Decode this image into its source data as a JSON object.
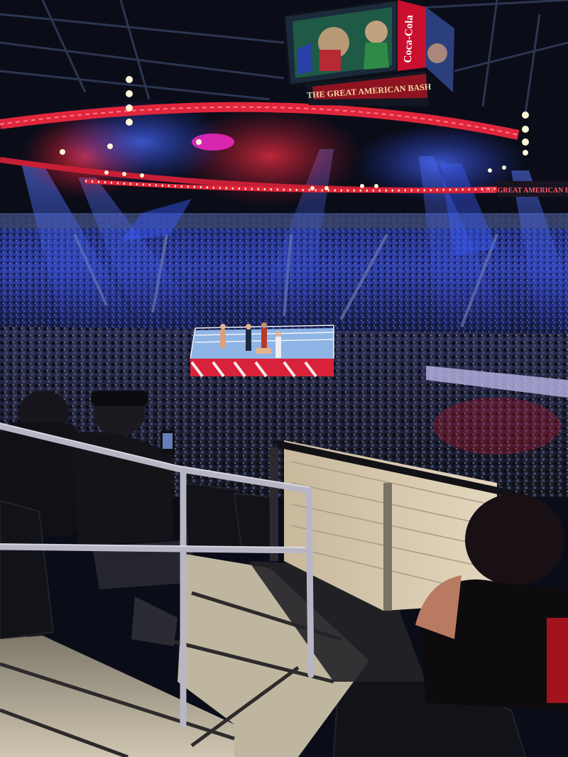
{
  "scene": {
    "signage": {
      "coca_cola": "Coca-Cola",
      "banner_main": "THE GREAT AMERICAN BASH",
      "banner_side": "THE GREAT AMERICAN BASH"
    },
    "colors": {
      "arena_dark": "#0a0d18",
      "spotlight_blue": "#2f5cff",
      "spotlight_red": "#ff2a3a",
      "spotlight_magenta": "#ff2ad0",
      "truss_red": "#e0263c",
      "ring_mat": "#8fb4e6",
      "railing": "#b8b6c4",
      "stairs": "#cfc6b1",
      "wall_panel": "#d9c9ad"
    }
  }
}
